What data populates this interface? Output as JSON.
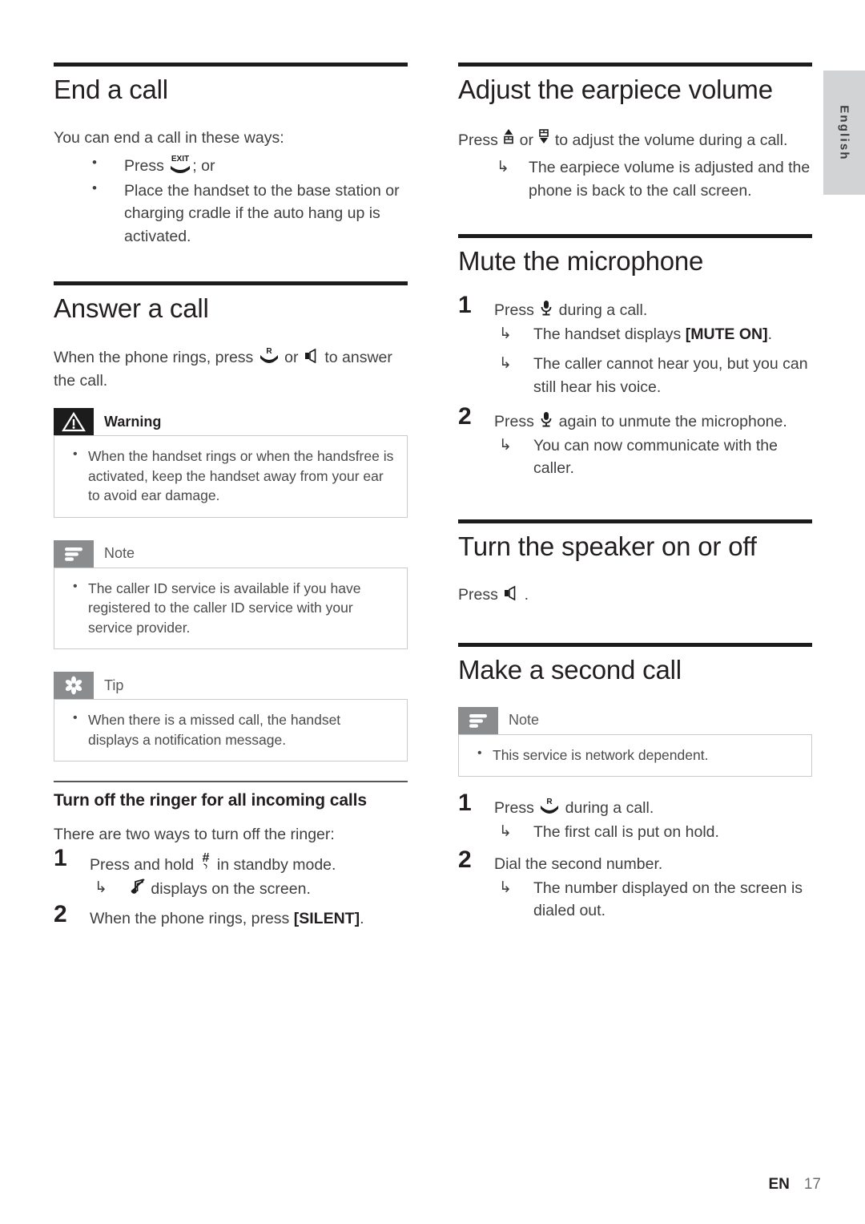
{
  "language_tab": {
    "label": "English"
  },
  "footer": {
    "code": "EN",
    "page": "17"
  },
  "left_column": {
    "end_call": {
      "title": "End a call",
      "intro": "You can end a call in these ways:",
      "bullets": [
        {
          "pre": "Press ",
          "icon": "exit-hangup-icon",
          "post": "; or"
        },
        {
          "pre": "Place the handset to the base station or charging cradle if the auto hang up is activated.",
          "icon": "",
          "post": ""
        }
      ]
    },
    "answer_call": {
      "title": "Answer a call",
      "intro_pre": "When the phone rings, press ",
      "intro_mid": " or ",
      "intro_post": " to answer the call.",
      "warning": {
        "label": "Warning",
        "icon": "warning-triangle-icon",
        "items": [
          "When the handset rings or when the handsfree is activated, keep the handset away from your ear to avoid ear damage."
        ]
      },
      "note": {
        "label": "Note",
        "icon": "note-lines-icon",
        "items": [
          "The caller ID service is available if you have registered to the caller ID service with your service provider."
        ]
      },
      "tip": {
        "label": "Tip",
        "icon": "tip-asterisk-icon",
        "items": [
          "When there is a missed call, the handset displays a notification message."
        ]
      }
    },
    "ringer_off": {
      "title": "Turn off the ringer for all incoming calls",
      "intro": "There are two ways to turn off the ringer:",
      "steps": [
        {
          "num": "1",
          "pre": "Press and hold ",
          "icon": "hash-key-icon",
          "post": " in standby mode.",
          "results": [
            {
              "pre": "",
              "icon": "ringer-off-note-icon",
              "post": " displays on the screen."
            }
          ]
        },
        {
          "num": "2",
          "pre": "When the phone rings, press ",
          "icon": "",
          "post": "",
          "bold": "[SILENT]",
          "tail": ".",
          "results": []
        }
      ]
    }
  },
  "right_column": {
    "earpiece_volume": {
      "title": "Adjust the earpiece volume",
      "intro_pre": "Press ",
      "intro_mid": " or ",
      "intro_post": " to adjust the volume during a call.",
      "results": [
        "The earpiece volume is adjusted and the phone is back to the call screen."
      ]
    },
    "mute_mic": {
      "title": "Mute the microphone",
      "steps": [
        {
          "num": "1",
          "pre": "Press ",
          "icon": "microphone-icon",
          "post": " during a call.",
          "results": [
            {
              "pre": "The handset displays ",
              "bold": "[MUTE ON]",
              "post": "."
            },
            {
              "pre": "The caller cannot hear you, but you can still hear his voice.",
              "bold": "",
              "post": ""
            }
          ]
        },
        {
          "num": "2",
          "pre": "Press ",
          "icon": "microphone-icon",
          "post": " again to unmute the microphone.",
          "results": [
            {
              "pre": "You can now communicate with the caller.",
              "bold": "",
              "post": ""
            }
          ]
        }
      ]
    },
    "speaker_toggle": {
      "title": "Turn the speaker on or off",
      "intro_pre": "Press ",
      "intro_post": " ."
    },
    "second_call": {
      "title": "Make a second call",
      "note": {
        "label": "Note",
        "icon": "note-lines-icon",
        "items": [
          "This service is network dependent."
        ]
      },
      "steps": [
        {
          "num": "1",
          "pre": "Press ",
          "icon": "recall-r-icon",
          "post": " during a call.",
          "results": [
            "The first call is put on hold."
          ]
        },
        {
          "num": "2",
          "pre": "Dial the second number.",
          "icon": "",
          "post": "",
          "results": [
            "The number displayed on the screen is dialed out."
          ]
        }
      ]
    }
  },
  "colors": {
    "rule": "#1c1c1c",
    "badge_gray": "#8b8c8e",
    "badge_black": "#1c1c1c",
    "tab_gray": "#d2d3d5",
    "body_text": "#3f3f41"
  }
}
